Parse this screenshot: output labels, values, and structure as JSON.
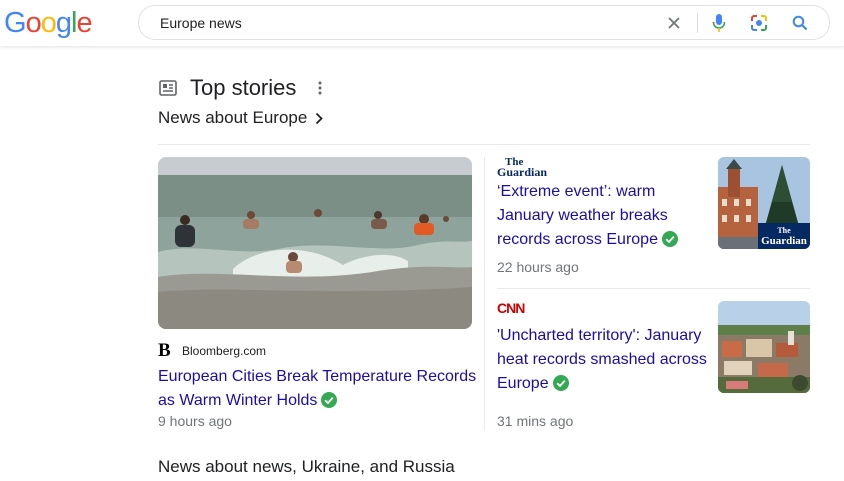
{
  "header": {
    "logo_text": "Google",
    "query": "Europe news",
    "icons": [
      "close-icon",
      "microphone-icon",
      "lens-camera-icon",
      "search-icon"
    ]
  },
  "top_stories": {
    "title": "Top stories",
    "subheading": "News about Europe",
    "left_story": {
      "publisher": "Bloomberg.com",
      "publisher_logo": "B",
      "headline": "European Cities Break Temperature Records as Warm Winter Holds",
      "time": "9 hours ago"
    },
    "right_stories": [
      {
        "publisher_logo_line1": "The",
        "publisher_logo_line2": "Guardian",
        "thumbnail_brand_line1": "The",
        "thumbnail_brand_line2": "Guardian",
        "headline": "‘Extreme event’: warm January weather breaks records across Europe",
        "time": "22 hours ago"
      },
      {
        "publisher_logo": "CNN",
        "headline": "'Uncharted territory': January heat records smashed across Europe",
        "time": "31 mins ago"
      }
    ]
  },
  "next_section": {
    "title": "News about news, Ukraine, and Russia"
  },
  "colors": {
    "link": "#1a0dab",
    "verified": "#34a853",
    "secondary_text": "#70757a",
    "cnn_red": "#cc0000",
    "guardian_blue": "#052962"
  }
}
